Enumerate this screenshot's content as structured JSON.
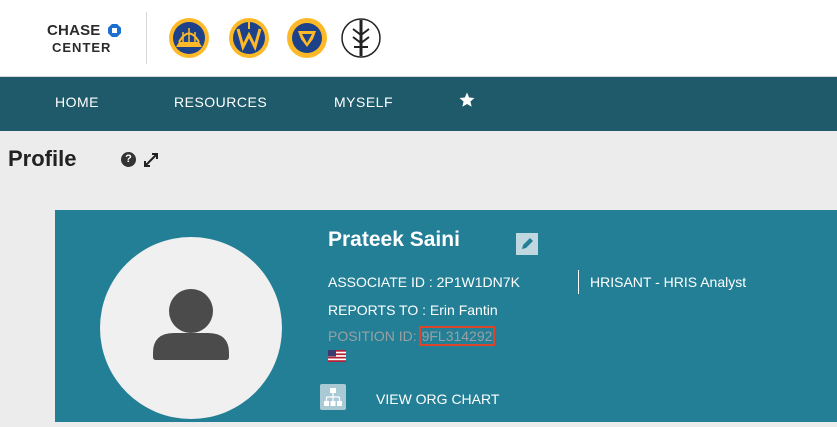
{
  "brand": {
    "line1": "CHASE",
    "line2": "CENTER"
  },
  "team_logos": [
    "warriors-logo-icon",
    "santa-cruz-warriors-logo-icon",
    "gsw-gaming-logo-icon",
    "valkyries-logo-icon"
  ],
  "nav": {
    "home": "HOME",
    "resources": "RESOURCES",
    "myself": "MYSELF",
    "favorites_icon": "star-icon"
  },
  "page": {
    "title": "Profile"
  },
  "profile": {
    "name": "Prateek Saini",
    "associate_id_label": "ASSOCIATE ID : 2P1W1DN7K",
    "department": "HRISANT - HRIS Analyst",
    "reports_to": "REPORTS TO : Erin Fantin",
    "position_label": "POSITION ID: ",
    "position_id": "9FL314292",
    "org_chart_link": "VIEW ORG CHART"
  },
  "colors": {
    "nav": "#1e5a69",
    "card": "#237f96",
    "highlight": "#d9462c"
  }
}
